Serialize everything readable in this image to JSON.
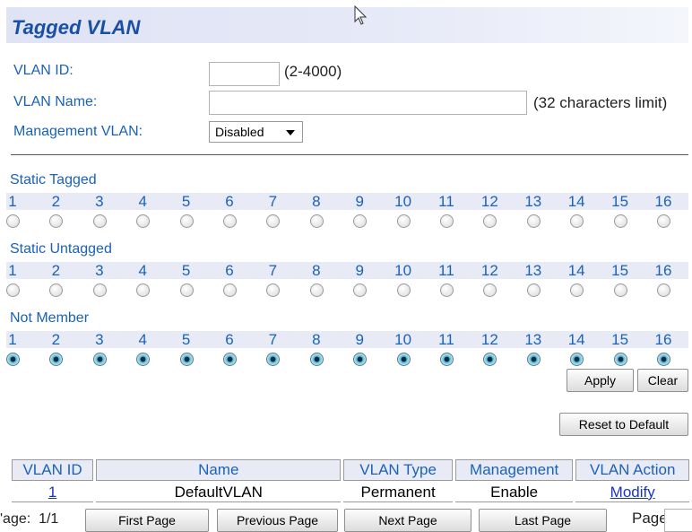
{
  "header": {
    "title": "Tagged VLAN"
  },
  "form": {
    "vlan_id_label": "VLAN ID:",
    "vlan_id_value": "",
    "vlan_id_hint": "(2-4000)",
    "vlan_name_label": "VLAN Name:",
    "vlan_name_value": "",
    "vlan_name_hint": "(32 characters limit)",
    "mgmt_label": "Management VLAN:",
    "mgmt_value": "Disabled"
  },
  "ports": [
    "1",
    "2",
    "3",
    "4",
    "5",
    "6",
    "7",
    "8",
    "9",
    "10",
    "11",
    "12",
    "13",
    "14",
    "15",
    "16"
  ],
  "sections": [
    {
      "label": "Static Tagged",
      "checked": []
    },
    {
      "label": "Static Untagged",
      "checked": []
    },
    {
      "label": "Not Member",
      "checked": [
        "1",
        "2",
        "3",
        "4",
        "5",
        "6",
        "7",
        "8",
        "9",
        "10",
        "11",
        "12",
        "13",
        "14",
        "15",
        "16"
      ]
    }
  ],
  "buttons": {
    "apply": "Apply",
    "clear": "Clear",
    "reset": "Reset to Default"
  },
  "table": {
    "headers": [
      "VLAN ID",
      "Name",
      "VLAN Type",
      "Management",
      "VLAN Action"
    ],
    "rows": [
      {
        "id": "1",
        "name": "DefaultVLAN",
        "type": "Permanent",
        "management": "Enable",
        "action": "Modify"
      }
    ]
  },
  "pagination": {
    "page_info": "'age:  1/1",
    "first": "First Page",
    "previous": "Previous Page",
    "next": "Next Page",
    "last": "Last Page",
    "page_label": "Page"
  }
}
